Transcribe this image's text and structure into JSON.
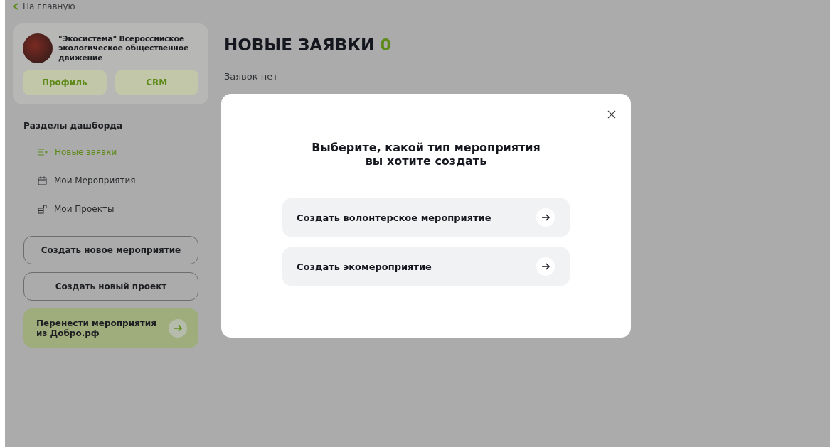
{
  "back_link": {
    "label": "На главную"
  },
  "profile": {
    "name": "\"Экосистема\" Всероссийское экологическое общественное движение",
    "buttons": [
      "Профиль",
      "CRM"
    ]
  },
  "sidebar": {
    "heading": "Разделы дашборда",
    "items": [
      {
        "label": "Новые заявки",
        "kind": "requests",
        "selected": true
      },
      {
        "label": "Мои Мероприятия",
        "kind": "calendar",
        "selected": false
      },
      {
        "label": "Мои Проекты",
        "kind": "projects",
        "selected": false
      }
    ],
    "actions": [
      "Создать новое мероприятие",
      "Создать новый проект"
    ],
    "import_card": {
      "label": "Перенести мероприятия из Добро.рф"
    }
  },
  "main": {
    "title": "НОВЫЕ ЗАЯВКИ",
    "count": "0",
    "empty_text": "Заявок нет"
  },
  "modal": {
    "title": "Выберите, какой тип мероприятия вы хотите создать",
    "options": [
      "Создать волонтерское мероприятие",
      "Создать экомероприятие"
    ]
  }
}
